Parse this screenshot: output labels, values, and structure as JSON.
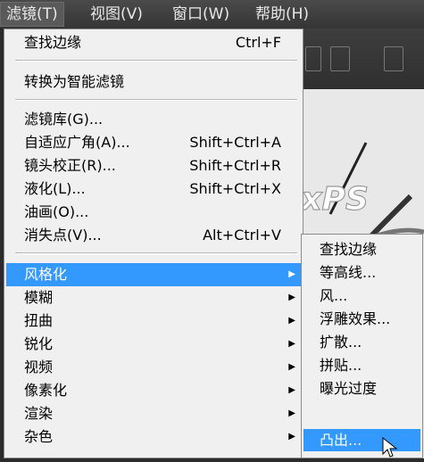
{
  "menubar": {
    "items": [
      {
        "label": "滤镜(T)"
      },
      {
        "label": "视图(V)"
      },
      {
        "label": "窗口(W)"
      },
      {
        "label": "帮助(H)"
      }
    ]
  },
  "filter_menu": {
    "last_filter": {
      "label": "查找边缘",
      "shortcut": "Ctrl+F"
    },
    "convert_smart": {
      "label": "转换为智能滤镜"
    },
    "items": [
      {
        "label": "滤镜库(G)...",
        "shortcut": ""
      },
      {
        "label": "自适应广角(A)...",
        "shortcut": "Shift+Ctrl+A"
      },
      {
        "label": "镜头校正(R)...",
        "shortcut": "Shift+Ctrl+R"
      },
      {
        "label": "液化(L)...",
        "shortcut": "Shift+Ctrl+X"
      },
      {
        "label": "油画(O)...",
        "shortcut": ""
      },
      {
        "label": "消失点(V)...",
        "shortcut": "Alt+Ctrl+V"
      }
    ],
    "categories": [
      {
        "label": "风格化"
      },
      {
        "label": "模糊"
      },
      {
        "label": "扭曲"
      },
      {
        "label": "锐化"
      },
      {
        "label": "视频"
      },
      {
        "label": "像素化"
      },
      {
        "label": "渲染"
      },
      {
        "label": "杂色"
      }
    ]
  },
  "stylize_submenu": {
    "items": [
      {
        "label": "查找边缘"
      },
      {
        "label": "等高线..."
      },
      {
        "label": "风..."
      },
      {
        "label": "浮雕效果..."
      },
      {
        "label": "扩散..."
      },
      {
        "label": "拼贴..."
      },
      {
        "label": "曝光过度"
      },
      {
        "label": "凸出..."
      }
    ]
  },
  "colors": {
    "highlight": "#3399ff",
    "menu_bg": "#f0f0f0",
    "menubar_bg": "#3c3c3c"
  }
}
